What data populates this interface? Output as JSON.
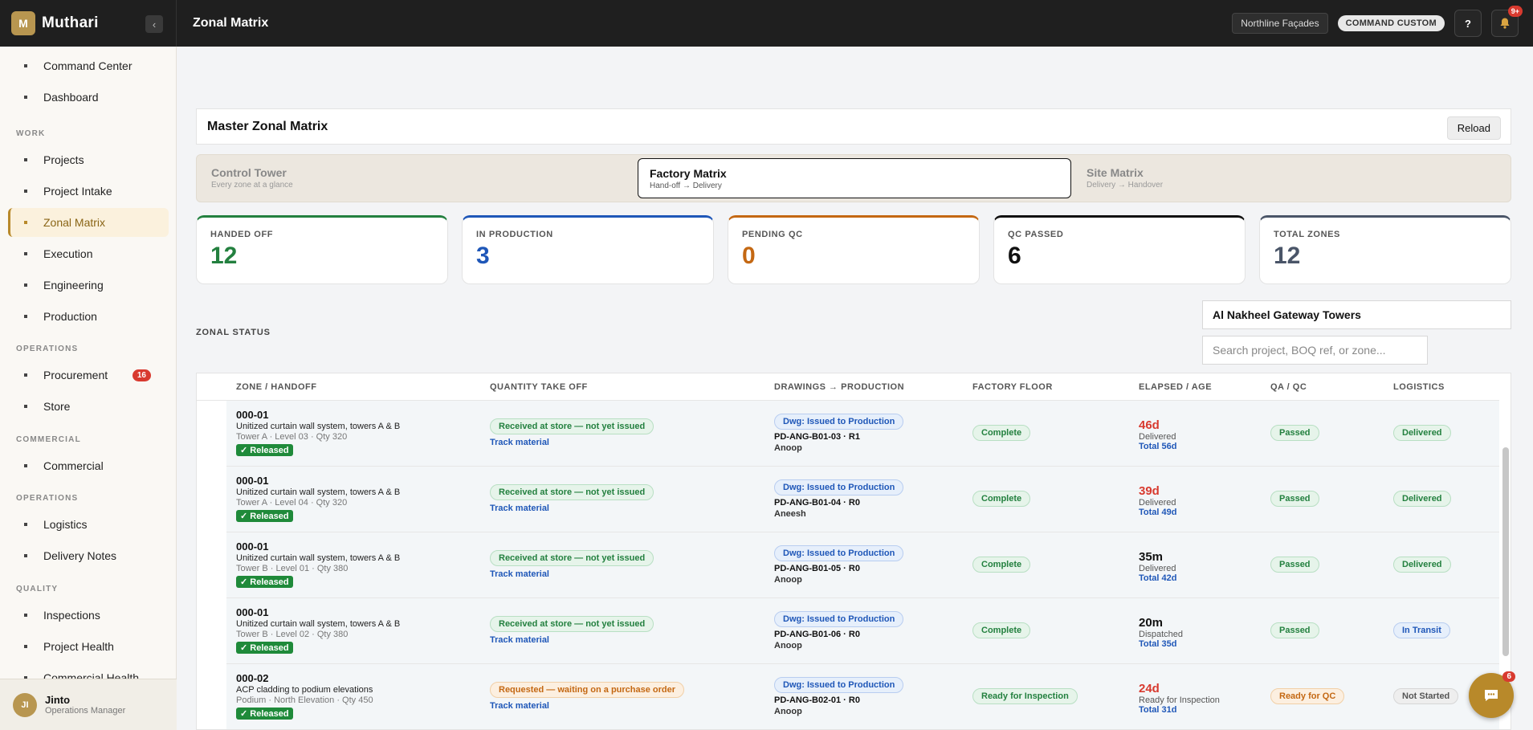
{
  "topbar": {
    "brand": "Muthari",
    "logo_glyph": "M",
    "collapse_glyph": "‹",
    "page_title": "Zonal Matrix",
    "org": "Northline Façades",
    "mode": "COMMAND CUSTOM",
    "help": "?",
    "notif_count": "9+"
  },
  "sidebar": {
    "items": [
      {
        "label": "Command Center"
      },
      {
        "label": "Dashboard"
      },
      {
        "label": "Projects"
      },
      {
        "label": "Project Intake"
      },
      {
        "label": "Zonal Matrix"
      },
      {
        "label": "Execution"
      },
      {
        "label": "Engineering"
      },
      {
        "label": "Production"
      },
      {
        "label": "Procurement",
        "badge": "16"
      },
      {
        "label": "Store"
      },
      {
        "label": "Commercial"
      },
      {
        "label": "Logistics"
      },
      {
        "label": "Delivery Notes"
      },
      {
        "label": "Inspections"
      },
      {
        "label": "Project Health"
      },
      {
        "label": "Commercial Health"
      }
    ],
    "sections": [
      "WORK",
      "OPERATIONS",
      "COMMERCIAL",
      "OPERATIONS",
      "QUALITY"
    ],
    "user": {
      "initials": "JI",
      "name": "Jinto",
      "role": "Operations Manager"
    }
  },
  "main": {
    "title": "Master Zonal Matrix",
    "reload": "Reload",
    "tabs": [
      {
        "title": "Control Tower",
        "sub": "Every zone at a glance"
      },
      {
        "title": "Factory Matrix",
        "sub": "Hand-off → Delivery"
      },
      {
        "title": "Site Matrix",
        "sub": "Delivery → Handover"
      }
    ],
    "stats": [
      {
        "label": "HANDED OFF",
        "value": "12",
        "color": "#23803f"
      },
      {
        "label": "IN PRODUCTION",
        "value": "3",
        "color": "#1f57b8"
      },
      {
        "label": "PENDING QC",
        "value": "0",
        "color": "#c46813"
      },
      {
        "label": "QC PASSED",
        "value": "6",
        "color": "#111111"
      },
      {
        "label": "TOTAL ZONES",
        "value": "12",
        "color": "#4a5568"
      }
    ],
    "zonal_status": "ZONAL STATUS",
    "project": "Al Nakheel Gateway Towers",
    "search_placeholder": "Search project, BOQ ref, or zone...",
    "columns": [
      "ZONE / HANDOFF",
      "QUANTITY TAKE OFF",
      "DRAWINGS → PRODUCTION",
      "FACTORY FLOOR",
      "ELAPSED / AGE",
      "QA / QC",
      "LOGISTICS"
    ],
    "rows": [
      {
        "zone": "000-01",
        "desc": "Unitized curtain wall system, towers A & B",
        "meta": "Tower A · Level 03 · Qty 320",
        "released": "✓ Released",
        "qto": "Received at store — not yet issued",
        "track": "Track material",
        "dwg": "Dwg: Issued to Production",
        "ref": "PD-ANG-B01-03 · R1",
        "by": "Anoop",
        "floor": "Complete",
        "age": "46d",
        "age_status": "Delivered",
        "age_total": "Total 56d",
        "qc": "Passed",
        "logistics": "Delivered"
      },
      {
        "zone": "000-01",
        "desc": "Unitized curtain wall system, towers A & B",
        "meta": "Tower A · Level 04 · Qty 320",
        "released": "✓ Released",
        "qto": "Received at store — not yet issued",
        "track": "Track material",
        "dwg": "Dwg: Issued to Production",
        "ref": "PD-ANG-B01-04 · R0",
        "by": "Aneesh",
        "floor": "Complete",
        "age": "39d",
        "age_status": "Delivered",
        "age_total": "Total 49d",
        "qc": "Passed",
        "logistics": "Delivered"
      },
      {
        "zone": "000-01",
        "desc": "Unitized curtain wall system, towers A & B",
        "meta": "Tower B · Level 01 · Qty 380",
        "released": "✓ Released",
        "qto": "Received at store — not yet issued",
        "track": "Track material",
        "dwg": "Dwg: Issued to Production",
        "ref": "PD-ANG-B01-05 · R0",
        "by": "Anoop",
        "floor": "Complete",
        "age": "35m",
        "age_status": "Delivered",
        "age_total": "Total 42d",
        "qc": "Passed",
        "logistics": "Delivered"
      },
      {
        "zone": "000-01",
        "desc": "Unitized curtain wall system, towers A & B",
        "meta": "Tower B · Level 02 · Qty 380",
        "released": "✓ Released",
        "qto": "Received at store — not yet issued",
        "track": "Track material",
        "dwg": "Dwg: Issued to Production",
        "ref": "PD-ANG-B01-06 · R0",
        "by": "Anoop",
        "floor": "Complete",
        "age": "20m",
        "age_status": "Dispatched",
        "age_total": "Total 35d",
        "qc": "Passed",
        "logistics": "In Transit"
      },
      {
        "zone": "000-02",
        "desc": "ACP cladding to podium elevations",
        "meta": "Podium · North Elevation · Qty 450",
        "released": "✓ Released",
        "qto": "Requested — waiting on a purchase order",
        "track": "Track material",
        "dwg": "Dwg: Issued to Production",
        "ref": "PD-ANG-B02-01 · R0",
        "by": "Anoop",
        "floor": "Ready for Inspection",
        "age": "24d",
        "age_status": "Ready for Inspection",
        "age_total": "Total 31d",
        "qc": "Ready for QC",
        "logistics": "Not Started"
      }
    ],
    "chat_count": "6"
  }
}
